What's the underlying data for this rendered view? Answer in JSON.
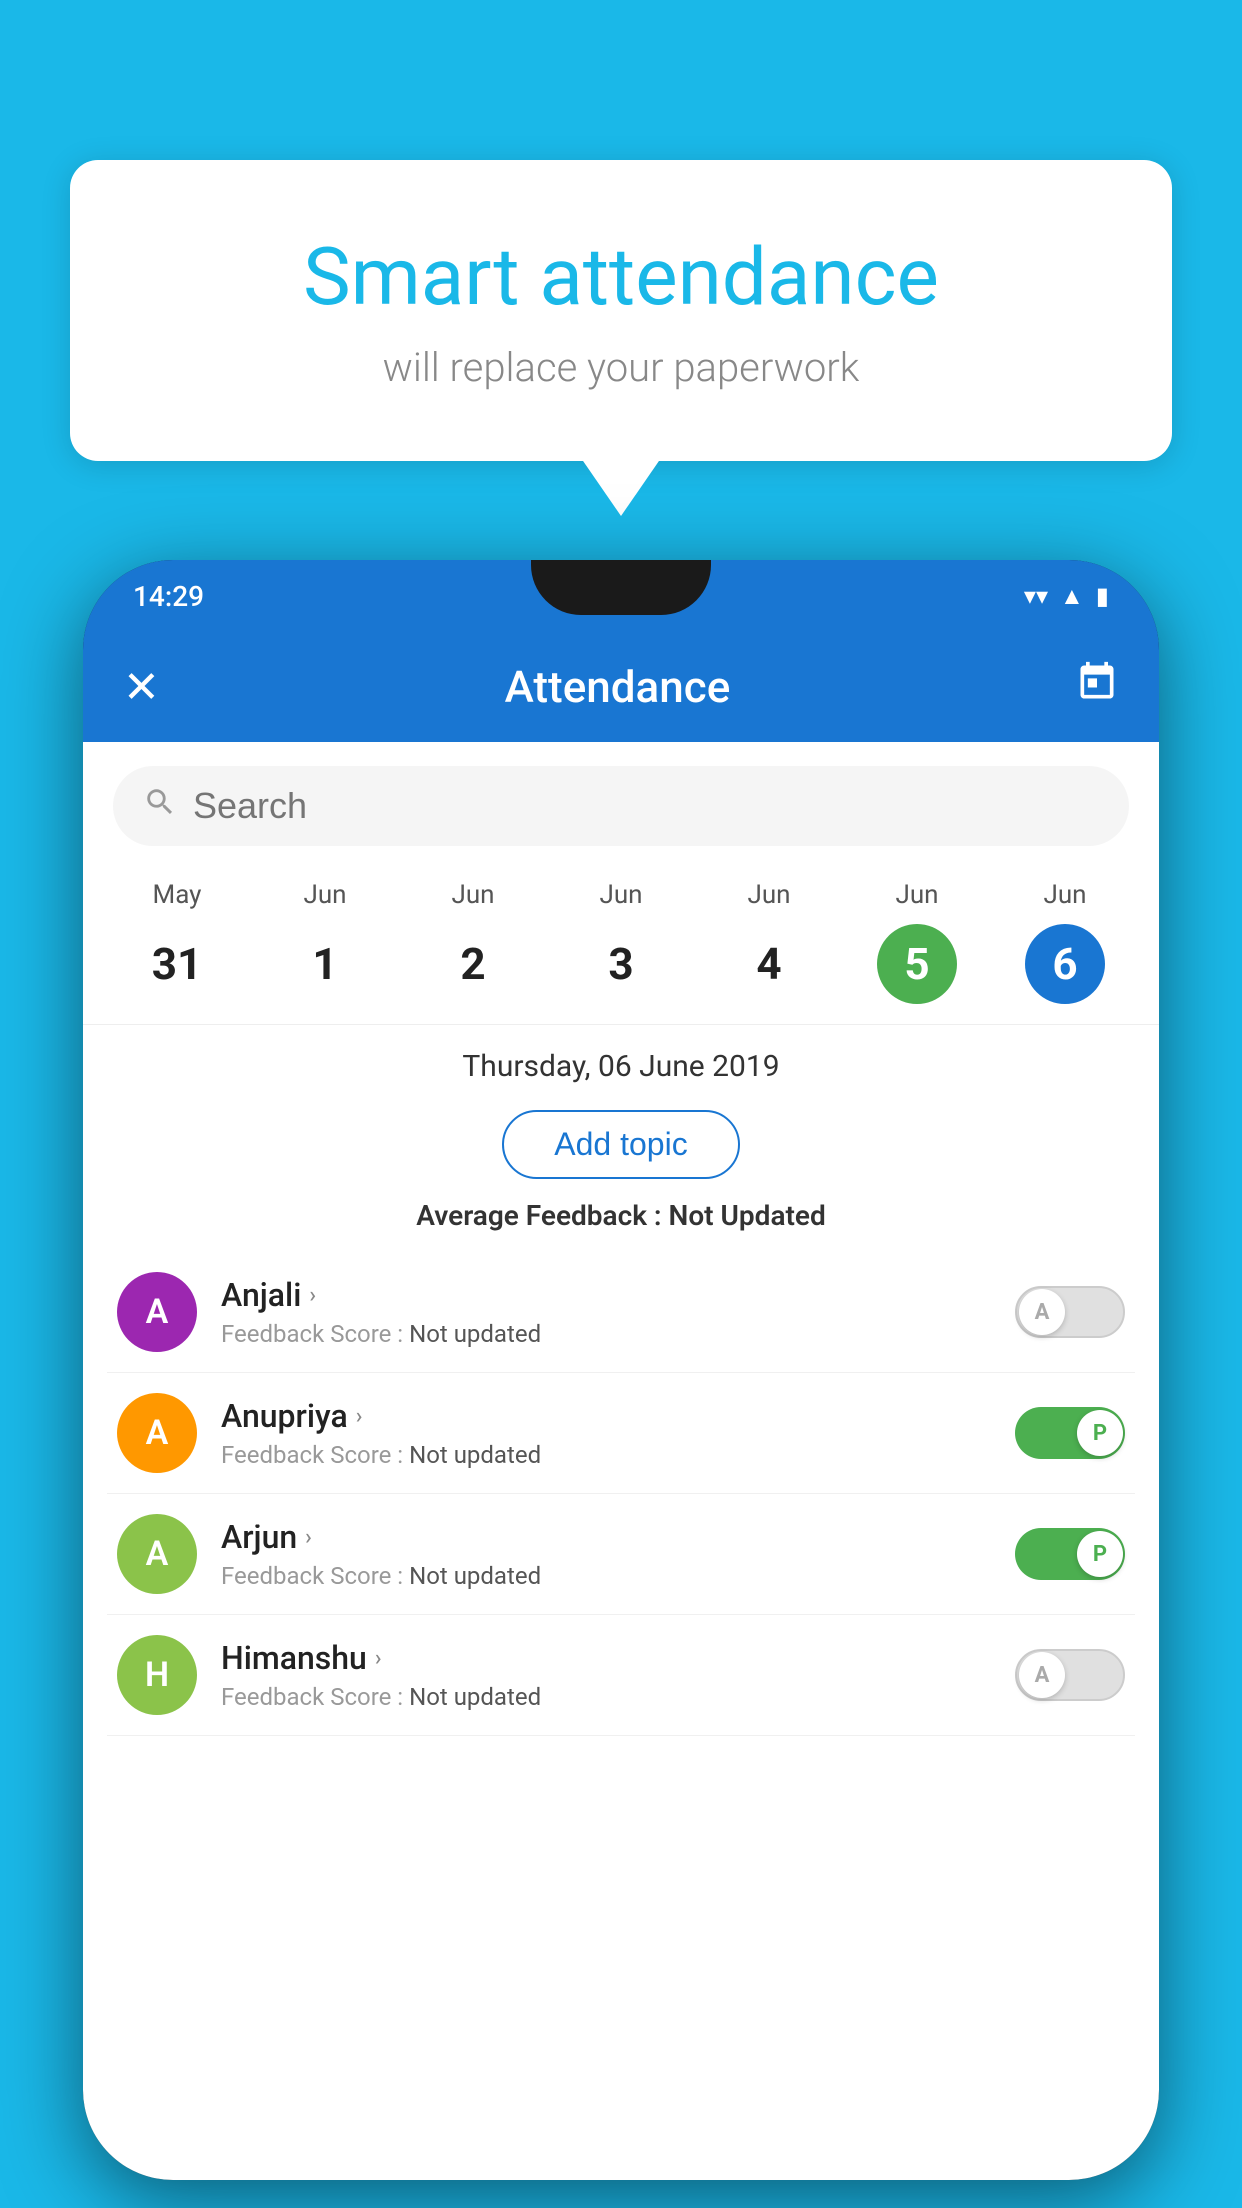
{
  "background_color": "#1ab8e8",
  "speech_bubble": {
    "title": "Smart attendance",
    "subtitle": "will replace your paperwork"
  },
  "status_bar": {
    "time": "14:29",
    "icons": [
      "wifi",
      "signal",
      "battery"
    ]
  },
  "app_bar": {
    "title": "Attendance",
    "close_icon": "✕",
    "calendar_icon": "📅"
  },
  "search": {
    "placeholder": "Search"
  },
  "calendar": {
    "days": [
      {
        "month": "May",
        "date": "31",
        "state": "normal"
      },
      {
        "month": "Jun",
        "date": "1",
        "state": "normal"
      },
      {
        "month": "Jun",
        "date": "2",
        "state": "normal"
      },
      {
        "month": "Jun",
        "date": "3",
        "state": "normal"
      },
      {
        "month": "Jun",
        "date": "4",
        "state": "normal"
      },
      {
        "month": "Jun",
        "date": "5",
        "state": "today"
      },
      {
        "month": "Jun",
        "date": "6",
        "state": "selected"
      }
    ]
  },
  "selected_date_label": "Thursday, 06 June 2019",
  "add_topic_label": "Add topic",
  "avg_feedback_label": "Average Feedback :",
  "avg_feedback_value": "Not Updated",
  "students": [
    {
      "name": "Anjali",
      "avatar_letter": "A",
      "avatar_color": "#9c27b0",
      "feedback_label": "Feedback Score :",
      "feedback_value": "Not updated",
      "toggle_state": "off",
      "toggle_label": "A"
    },
    {
      "name": "Anupriya",
      "avatar_letter": "A",
      "avatar_color": "#ff9800",
      "feedback_label": "Feedback Score :",
      "feedback_value": "Not updated",
      "toggle_state": "on",
      "toggle_label": "P"
    },
    {
      "name": "Arjun",
      "avatar_letter": "A",
      "avatar_color": "#8bc34a",
      "feedback_label": "Feedback Score :",
      "feedback_value": "Not updated",
      "toggle_state": "on",
      "toggle_label": "P"
    },
    {
      "name": "Himanshu",
      "avatar_letter": "H",
      "avatar_color": "#8bc34a",
      "feedback_label": "Feedback Score :",
      "feedback_value": "Not updated",
      "toggle_state": "off",
      "toggle_label": "A"
    }
  ]
}
